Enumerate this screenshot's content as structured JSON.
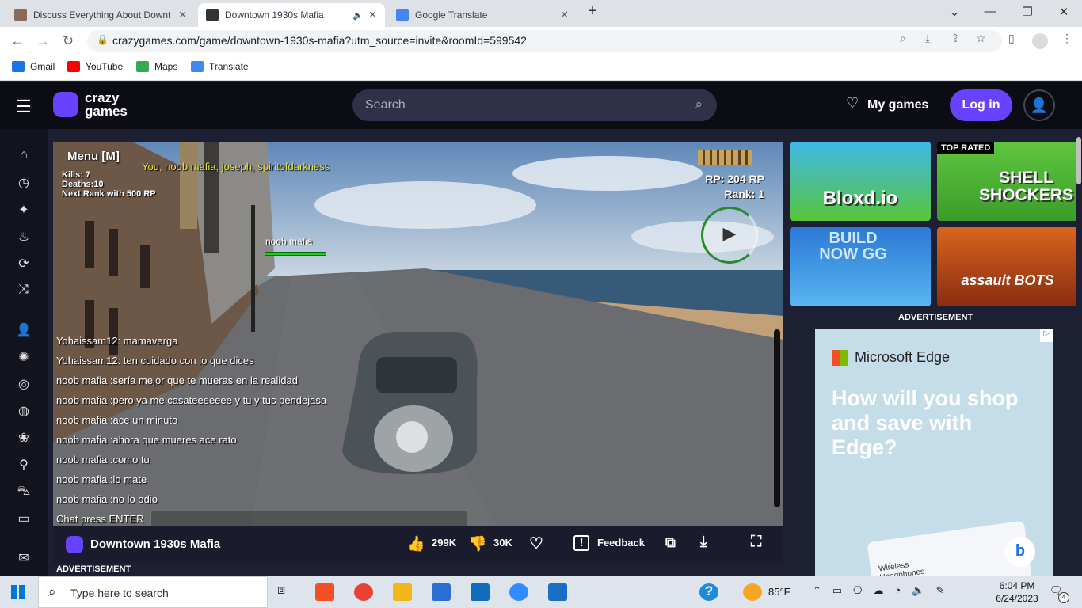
{
  "browser": {
    "tabs": [
      {
        "title": "Discuss Everything About Downt",
        "active": false
      },
      {
        "title": "Downtown 1930s Mafia",
        "active": true
      },
      {
        "title": "Google Translate",
        "active": false
      }
    ],
    "new_tab_label": "+",
    "url": "crazygames.com/game/downtown-1930s-mafia?utm_source=invite&roomId=599542",
    "bookmarks": [
      "Gmail",
      "YouTube",
      "Maps",
      "Translate"
    ]
  },
  "site": {
    "logo_line1": "crazy",
    "logo_line2": "games",
    "search_placeholder": "Search",
    "my_games": "My games",
    "login": "Log in"
  },
  "game": {
    "menu": "Menu [M]",
    "players_line": "You, noob mafia, joseph, spiritofdarkness",
    "kills_label": "Kills:",
    "kills_value": "7",
    "deaths": "Deaths:10",
    "next_rank": "Next Rank with 500 RP",
    "rp": "RP: 204 RP",
    "rank": "Rank: 1",
    "player_tag": "noob mafia",
    "chat_messages": [
      "Yohaissam12: mamaverga",
      "Yohaissam12: ten cuidado con lo que dices",
      "noob mafia :sería mejor que te mueras en la realidad",
      "noob mafia :pero ya me casateeeeeee y tu y tus pendejasa",
      "noob mafia :ace un minuto",
      "noob mafia :ahora que mueres ace rato",
      "noob mafia :como tu",
      "noob mafia :lo mate",
      "noob mafia :no lo odio"
    ],
    "chat_prompt": "Chat press  ENTER"
  },
  "footer": {
    "title": "Downtown 1930s Mafia",
    "likes": "299K",
    "dislikes": "30K",
    "feedback": "Feedback",
    "advertisement": "ADVERTISEMENT"
  },
  "recommended": [
    {
      "name": "Bloxd.io",
      "badge": ""
    },
    {
      "name": "SHELL SHOCKERS",
      "badge": "TOP RATED"
    },
    {
      "name": "BUILD NOW GG",
      "badge": ""
    },
    {
      "name": "assault BOTS",
      "badge": ""
    }
  ],
  "ad": {
    "label": "ADVERTISEMENT",
    "brand": "Microsoft Edge",
    "headline": "How will you shop and save with Edge?",
    "product": "Wireless Headphones"
  },
  "taskbar": {
    "search_placeholder": "Type here to search",
    "weather": "85°F",
    "time": "6:04 PM",
    "date": "6/24/2023",
    "notifications": "4"
  }
}
